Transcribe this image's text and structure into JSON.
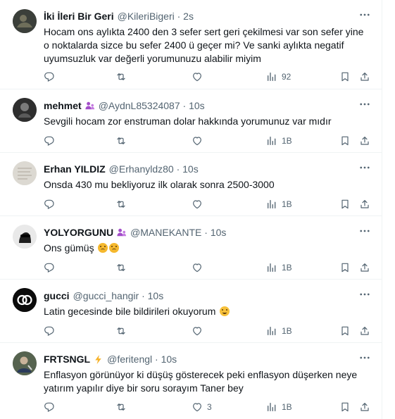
{
  "tweets": [
    {
      "name": "İki İleri Bir Geri",
      "handle": "@KileriBigeri · 2s",
      "text": "Hocam ons aylıkta 2400 den 3 sefer sert geri çekilmesi var son sefer yine o noktalarda sizce bu sefer 2400 ü geçer mi? Ve sanki aylıkta negatif uyumsuzluk var değerli yorumunuzu alabilir miyim",
      "likes": "",
      "views": "92",
      "verified": false
    },
    {
      "name": "mehmet",
      "handle": "@AydnL85324087 · 10s",
      "text": "Sevgili hocam zor enstruman dolar hakkında yorumunuz var mıdır",
      "likes": "",
      "views": "1B",
      "verified": true
    },
    {
      "name": "Erhan YILDIZ",
      "handle": "@Erhanyldz80 · 10s",
      "text": "Onsda 430 mu bekliyoruz ilk olarak sonra 2500-3000",
      "likes": "",
      "views": "1B",
      "verified": false
    },
    {
      "name": "YOLYORGUNU",
      "handle": "@MANEKANTE · 10s",
      "text": "Ons gümüş",
      "likes": "",
      "views": "1B",
      "verified": true
    },
    {
      "name": "gucci",
      "handle": "@gucci_hangir · 10s",
      "text": "Latin gecesinde bile bildirileri okuyorum",
      "likes": "",
      "views": "1B",
      "verified": false
    },
    {
      "name": "FRTSNGL",
      "handle": "@feritengl · 10s",
      "text": "Enflasyon görünüyor ki düşüş gösterecek peki enflasyon düşerken neye yatırım yapılır diye bir soru sorayım Taner bey",
      "likes": "3",
      "views": "1B",
      "verified": false
    }
  ],
  "colors": {
    "text": "#0f1419",
    "secondary": "#536471",
    "divider": "#eff3f4",
    "badge": "#a34ec9",
    "lightning": "#f7b32b"
  },
  "icons": [
    "reply-icon",
    "retweet-icon",
    "like-icon",
    "views-icon",
    "bookmark-icon",
    "share-icon",
    "more-icon"
  ]
}
